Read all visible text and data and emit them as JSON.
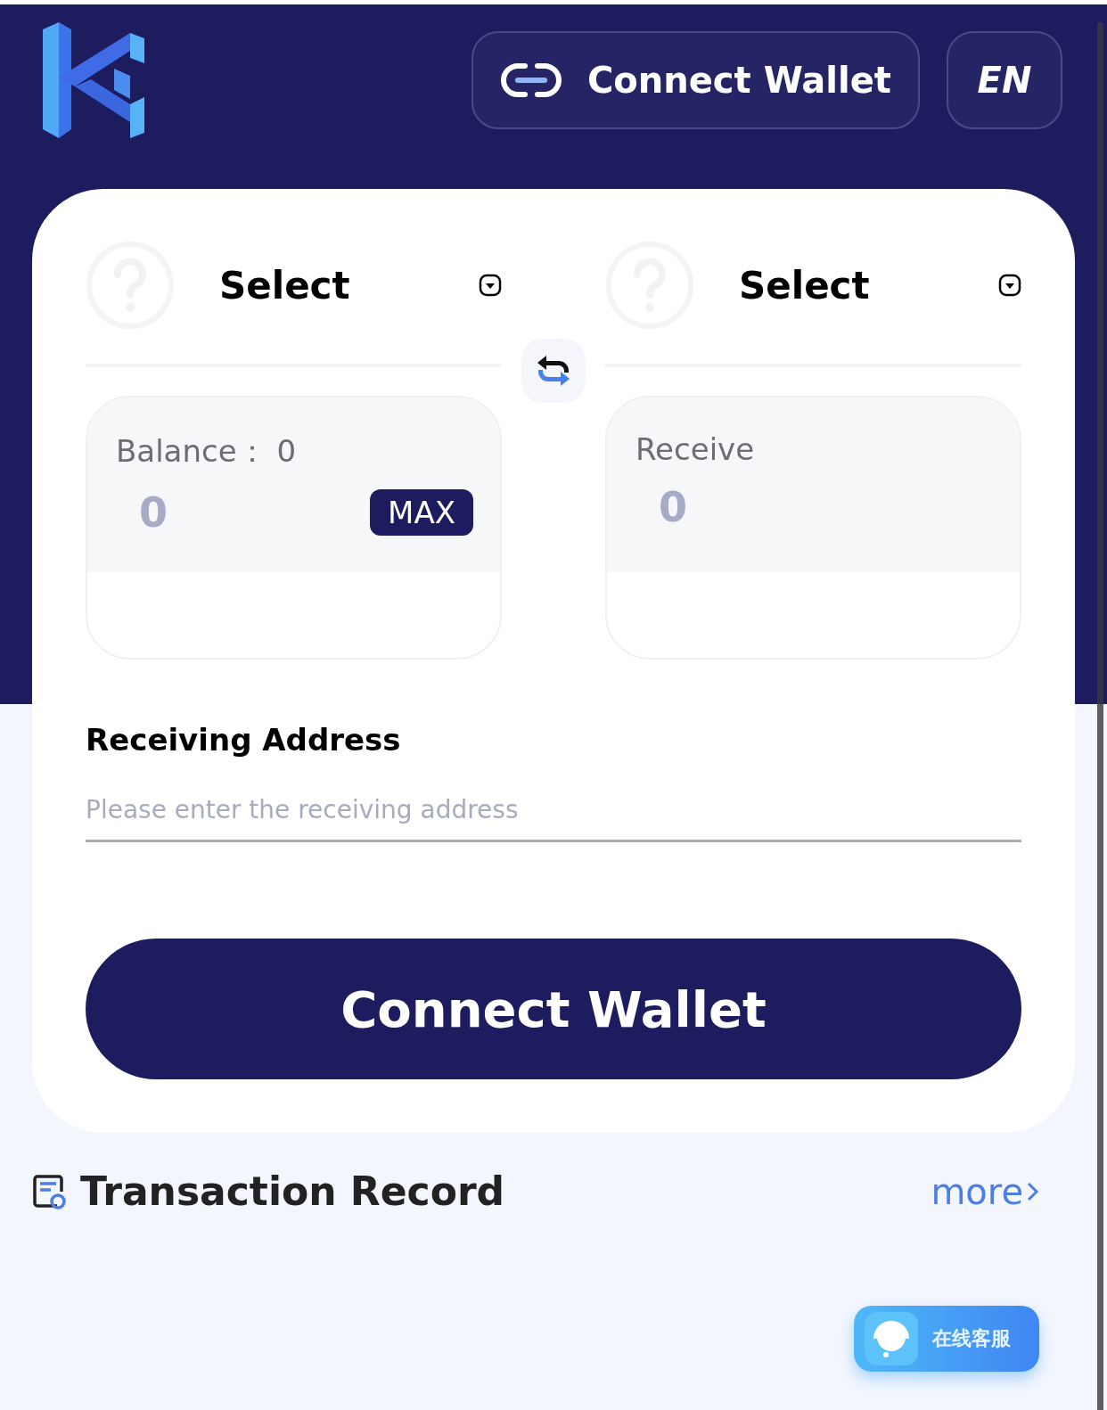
{
  "header": {
    "connect_button": "Connect Wallet",
    "language_button": "EN"
  },
  "swap": {
    "from": {
      "token_label": "Select",
      "balance_label": "Balance：",
      "balance_value": "0",
      "amount": "0",
      "max_button": "MAX"
    },
    "to": {
      "token_label": "Select",
      "receive_label": "Receive",
      "amount": "0"
    }
  },
  "address": {
    "label": "Receiving Address",
    "placeholder": "Please enter the receiving address"
  },
  "submit_button": "Connect Wallet",
  "records": {
    "title": "Transaction Record",
    "more_link": "more"
  },
  "support_button": "在线客服"
}
